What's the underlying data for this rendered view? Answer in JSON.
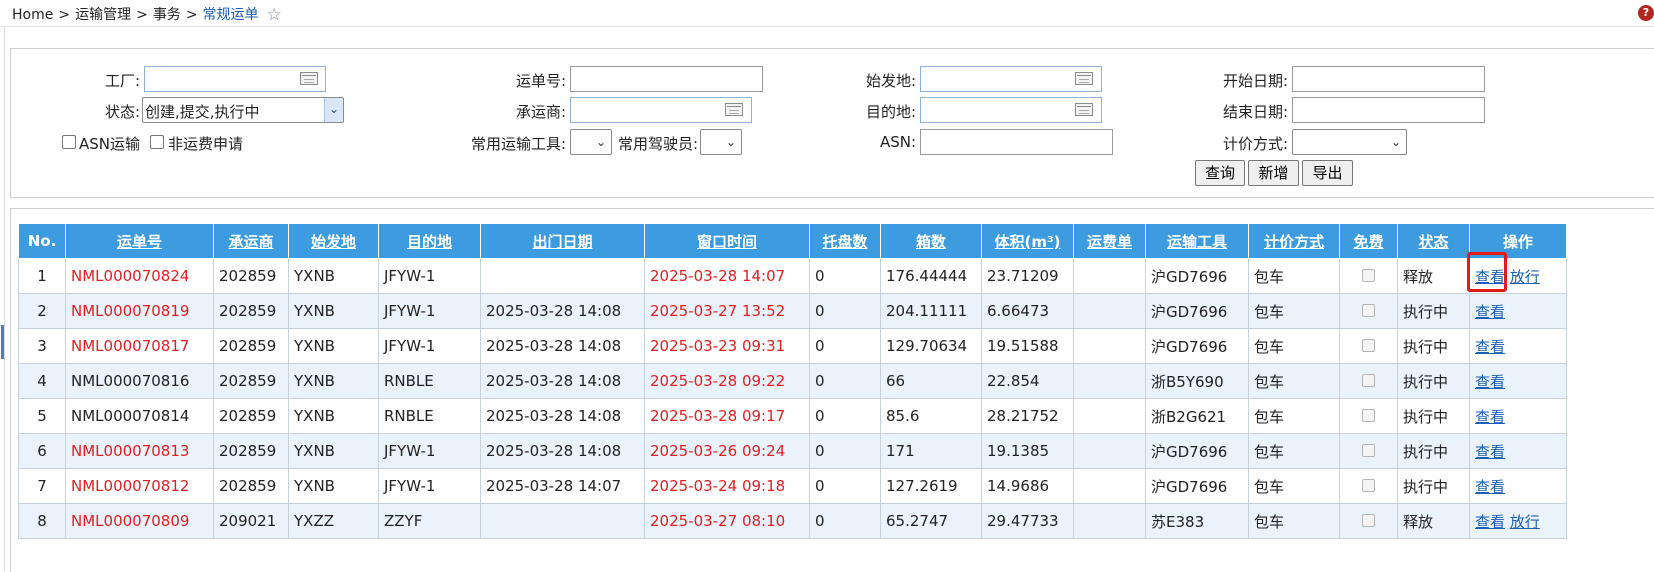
{
  "breadcrumb": [
    "Home",
    "运输管理",
    "事务",
    "常规运单"
  ],
  "breadcrumb_sep": ">",
  "colors": {
    "header_bg": "#3d9be0",
    "row_alt": "#eaf2fb",
    "alert_text": "#e02020",
    "link": "#1a5fb4",
    "highlight": "#e11a1a"
  },
  "filters": {
    "factory_label": "工厂:",
    "factory_value": "",
    "status_label": "状态:",
    "status_value": "创建,提交,执行中",
    "asn_transport_label": "ASN运输",
    "non_freight_label": "非运费申请",
    "waybill_label": "运单号:",
    "waybill_value": "",
    "carrier_label": "承运商:",
    "carrier_value": "",
    "tool_label": "常用运输工具:",
    "tool_value": "",
    "driver_label": "常用驾驶员:",
    "driver_value": "",
    "origin_label": "始发地:",
    "origin_value": "",
    "dest_label": "目的地:",
    "dest_value": "",
    "asn_label": "ASN:",
    "asn_value": "",
    "start_date_label": "开始日期:",
    "start_date_value": "",
    "end_date_label": "结束日期:",
    "end_date_value": "",
    "pricing_label": "计价方式:",
    "pricing_value": "",
    "query_button": "查询",
    "add_button": "新增",
    "export_button": "导出"
  },
  "table": {
    "columns": [
      "No.",
      "运单号",
      "承运商",
      "始发地",
      "目的地",
      "出门日期",
      "窗口时间",
      "托盘数",
      "箱数",
      "体积(m³)",
      "运费单",
      "运输工具",
      "计价方式",
      "免费",
      "状态",
      "操作"
    ],
    "rows": [
      {
        "no": "1",
        "waybill": "NML000070824",
        "waybill_red": true,
        "carrier": "202859",
        "origin": "YXNB",
        "dest": "JFYW-1",
        "exit_date": "",
        "window": "2025-03-28 14:07",
        "pallets": "0",
        "boxes": "176.44444",
        "volume": "23.71209",
        "freight": "",
        "vehicle": "沪GD7696",
        "pricing": "包车",
        "status": "释放",
        "view": "查看",
        "release": "放行"
      },
      {
        "no": "2",
        "waybill": "NML000070819",
        "waybill_red": true,
        "carrier": "202859",
        "origin": "YXNB",
        "dest": "JFYW-1",
        "exit_date": "2025-03-28 14:08",
        "window": "2025-03-27 13:52",
        "pallets": "0",
        "boxes": "204.11111",
        "volume": "6.66473",
        "freight": "",
        "vehicle": "沪GD7696",
        "pricing": "包车",
        "status": "执行中",
        "view": "查看",
        "release": ""
      },
      {
        "no": "3",
        "waybill": "NML000070817",
        "waybill_red": true,
        "carrier": "202859",
        "origin": "YXNB",
        "dest": "JFYW-1",
        "exit_date": "2025-03-28 14:08",
        "window": "2025-03-23 09:31",
        "pallets": "0",
        "boxes": "129.70634",
        "volume": "19.51588",
        "freight": "",
        "vehicle": "沪GD7696",
        "pricing": "包车",
        "status": "执行中",
        "view": "查看",
        "release": ""
      },
      {
        "no": "4",
        "waybill": "NML000070816",
        "waybill_red": false,
        "carrier": "202859",
        "origin": "YXNB",
        "dest": "RNBLE",
        "exit_date": "2025-03-28 14:08",
        "window": "2025-03-28 09:22",
        "pallets": "0",
        "boxes": "66",
        "volume": "22.854",
        "freight": "",
        "vehicle": "浙B5Y690",
        "pricing": "包车",
        "status": "执行中",
        "view": "查看",
        "release": ""
      },
      {
        "no": "5",
        "waybill": "NML000070814",
        "waybill_red": false,
        "carrier": "202859",
        "origin": "YXNB",
        "dest": "RNBLE",
        "exit_date": "2025-03-28 14:08",
        "window": "2025-03-28 09:17",
        "pallets": "0",
        "boxes": "85.6",
        "volume": "28.21752",
        "freight": "",
        "vehicle": "浙B2G621",
        "pricing": "包车",
        "status": "执行中",
        "view": "查看",
        "release": ""
      },
      {
        "no": "6",
        "waybill": "NML000070813",
        "waybill_red": true,
        "carrier": "202859",
        "origin": "YXNB",
        "dest": "JFYW-1",
        "exit_date": "2025-03-28 14:08",
        "window": "2025-03-26 09:24",
        "pallets": "0",
        "boxes": "171",
        "volume": "19.1385",
        "freight": "",
        "vehicle": "沪GD7696",
        "pricing": "包车",
        "status": "执行中",
        "view": "查看",
        "release": ""
      },
      {
        "no": "7",
        "waybill": "NML000070812",
        "waybill_red": true,
        "carrier": "202859",
        "origin": "YXNB",
        "dest": "JFYW-1",
        "exit_date": "2025-03-28 14:07",
        "window": "2025-03-24 09:18",
        "pallets": "0",
        "boxes": "127.2619",
        "volume": "14.9686",
        "freight": "",
        "vehicle": "沪GD7696",
        "pricing": "包车",
        "status": "执行中",
        "view": "查看",
        "release": ""
      },
      {
        "no": "8",
        "waybill": "NML000070809",
        "waybill_red": true,
        "carrier": "209021",
        "origin": "YXZZ",
        "dest": "ZZYF",
        "exit_date": "",
        "window": "2025-03-27 08:10",
        "pallets": "0",
        "boxes": "65.2747",
        "volume": "29.47733",
        "freight": "",
        "vehicle": "苏E383",
        "pricing": "包车",
        "status": "释放",
        "view": "查看",
        "release": "放行"
      }
    ]
  }
}
